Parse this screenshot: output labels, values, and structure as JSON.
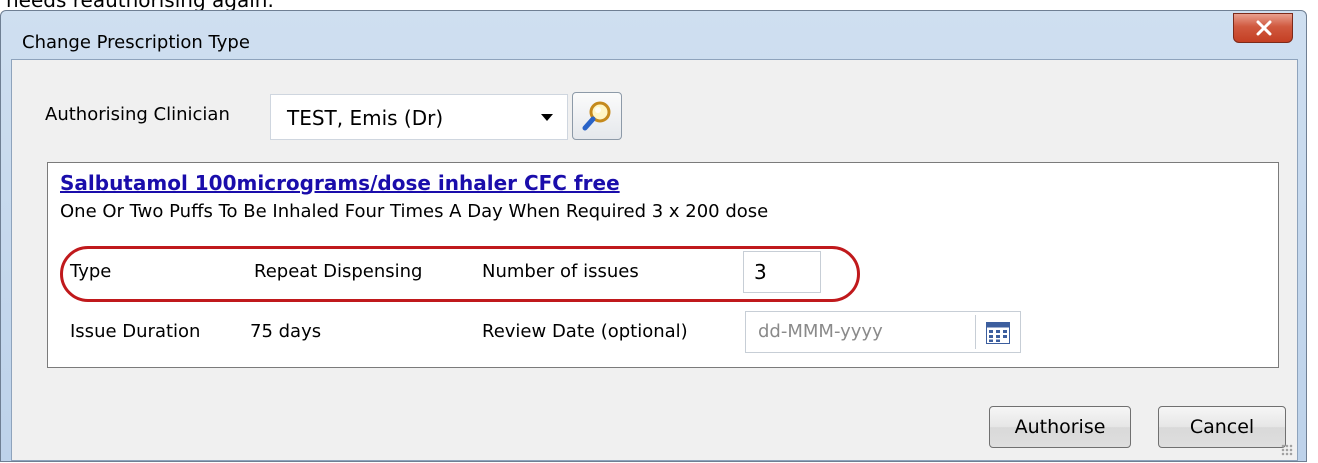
{
  "top_text": "needs reauthorising again.",
  "window": {
    "title": "Change Prescription Type",
    "close_label": "X"
  },
  "authorising": {
    "label": "Authorising Clinician",
    "value": "TEST, Emis (Dr)"
  },
  "medication": {
    "name": "Salbutamol 100micrograms/dose inhaler CFC free",
    "dosage": "One Or Two Puffs To Be Inhaled Four Times A Day When Required  3 x 200 dose",
    "type_label": "Type",
    "type_value": "Repeat Dispensing",
    "issues_label": "Number of issues",
    "issues_value": "3",
    "duration_label": "Issue Duration",
    "duration_value": "75 days",
    "review_label": "Review Date (optional)",
    "review_placeholder": "dd-MMM-yyyy"
  },
  "buttons": {
    "authorise": "Authorise",
    "cancel": "Cancel"
  },
  "colors": {
    "link": "#1a0dab",
    "highlight": "#c0191c",
    "close": "#c43f23"
  }
}
